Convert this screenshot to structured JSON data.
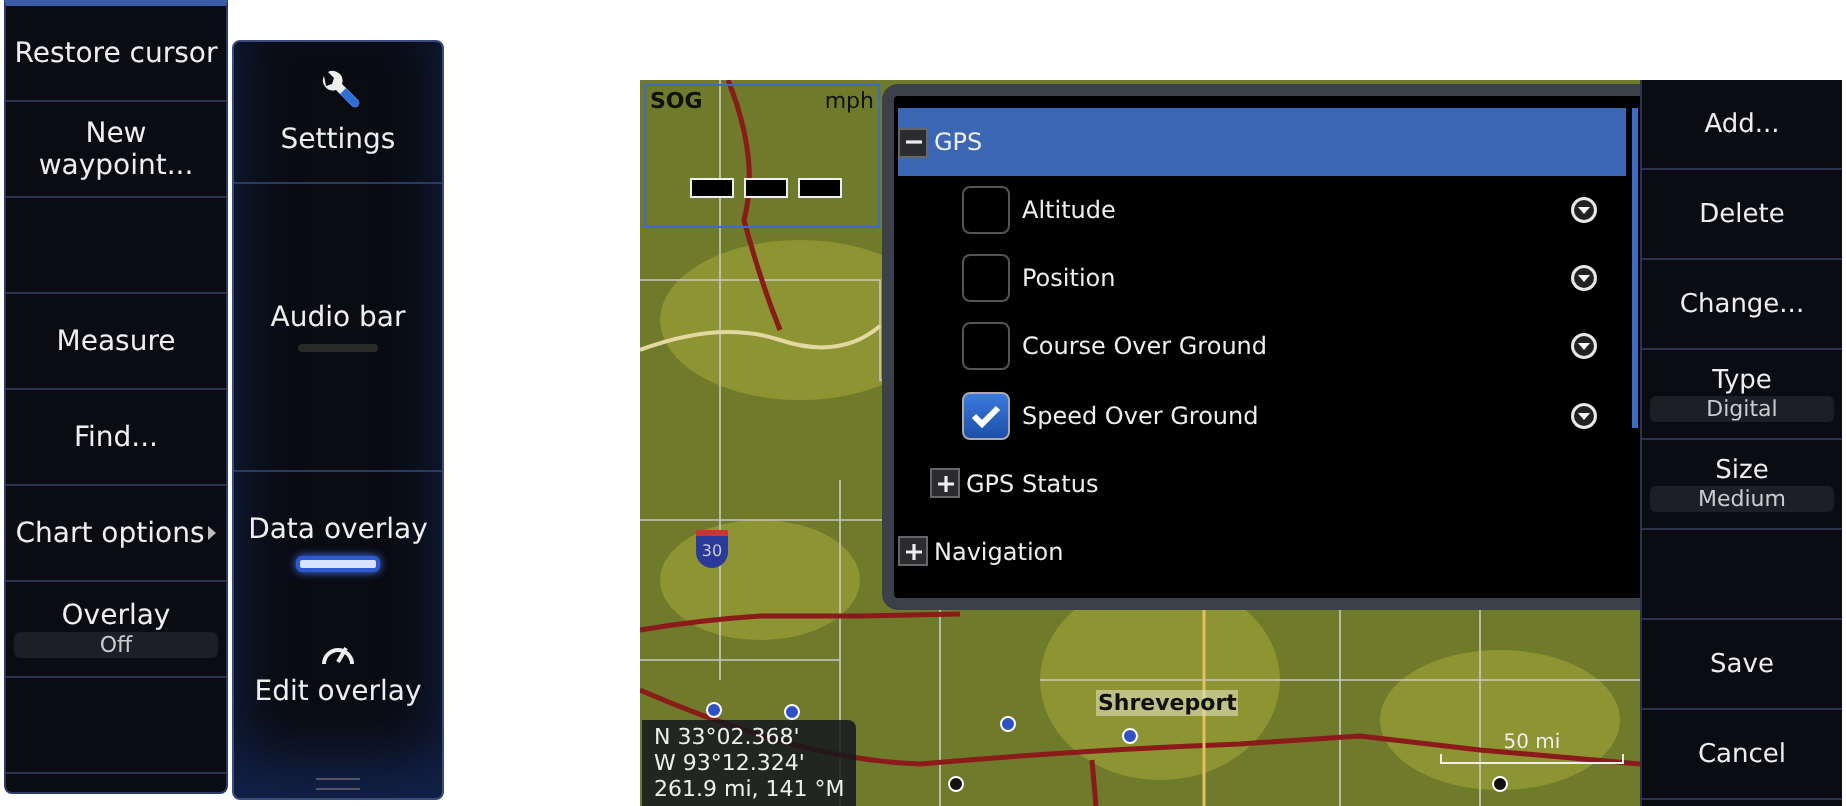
{
  "menu": {
    "items": [
      {
        "kind": "button",
        "label": "Restore cursor"
      },
      {
        "kind": "button",
        "label": "New waypoint..."
      },
      {
        "kind": "blank"
      },
      {
        "kind": "button",
        "label": "Measure"
      },
      {
        "kind": "button",
        "label": "Find..."
      },
      {
        "kind": "submenu",
        "label": "Chart options"
      },
      {
        "kind": "value",
        "label": "Overlay",
        "value": "Off"
      },
      {
        "kind": "blank"
      }
    ]
  },
  "settings_menu": {
    "items": [
      {
        "kind": "icon",
        "label": "Settings"
      },
      {
        "kind": "toggle",
        "label": "Audio bar",
        "on": false
      },
      {
        "kind": "toggle",
        "label": "Data overlay",
        "on": true
      },
      {
        "kind": "gauge",
        "label": "Edit overlay"
      }
    ]
  },
  "chart": {
    "gauge_label": "SOG",
    "gauge_unit": "mph",
    "highway": "30",
    "city": "Shreveport",
    "scale": "50 mi",
    "position": [
      "N  33°02.368'",
      "W  93°12.324'",
      "261.9 mi, 141 °M"
    ]
  },
  "dialog": {
    "tree": [
      {
        "label": "GPS",
        "expanded": true,
        "selected": true,
        "children": [
          {
            "label": "Altitude",
            "checked": false
          },
          {
            "label": "Position",
            "checked": false
          },
          {
            "label": "Course Over Ground",
            "checked": false
          },
          {
            "label": "Speed Over Ground",
            "checked": true
          },
          {
            "label": "GPS Status",
            "expanded": false,
            "selected": false
          }
        ]
      },
      {
        "label": "Navigation",
        "expanded": false,
        "selected": false
      }
    ]
  },
  "side_menu": {
    "items": [
      {
        "kind": "button",
        "label": "Add..."
      },
      {
        "kind": "button",
        "label": "Delete"
      },
      {
        "kind": "button",
        "label": "Change..."
      },
      {
        "kind": "value",
        "label": "Type",
        "value": "Digital"
      },
      {
        "kind": "value",
        "label": "Size",
        "value": "Medium"
      },
      {
        "kind": "blank"
      },
      {
        "kind": "button",
        "label": "Save"
      },
      {
        "kind": "button",
        "label": "Cancel"
      }
    ]
  }
}
